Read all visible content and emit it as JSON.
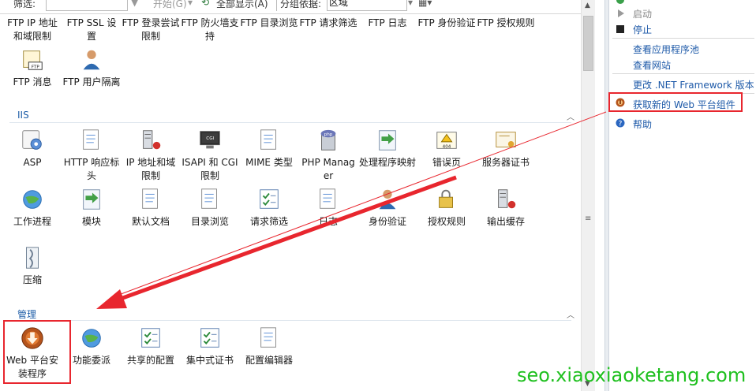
{
  "toolbar": {
    "filter_label": "筛选:",
    "start_label": "开始(G)",
    "show_all_label": "全部显示(A)",
    "group_by_label": "分组依据:",
    "group_by_value": "区域"
  },
  "ftp_row1": [
    {
      "label": "FTP IP 地址和域限制",
      "icon": "ftp-ip-restrictions-icon"
    },
    {
      "label": "FTP SSL 设置",
      "icon": "ftp-ssl-icon"
    },
    {
      "label": "FTP 登录尝试限制",
      "icon": "ftp-logon-attempt-icon"
    },
    {
      "label": "FTP 防火墙支持",
      "icon": "ftp-firewall-icon"
    },
    {
      "label": "FTP 目录浏览",
      "icon": "ftp-directory-browsing-icon"
    },
    {
      "label": "FTP 请求筛选",
      "icon": "ftp-request-filtering-icon"
    },
    {
      "label": "FTP 日志",
      "icon": "ftp-logging-icon"
    },
    {
      "label": "FTP 身份验证",
      "icon": "ftp-authentication-icon"
    },
    {
      "label": "FTP 授权规则",
      "icon": "ftp-authorization-icon"
    }
  ],
  "ftp_row2": [
    {
      "label": "FTP 消息",
      "icon": "ftp-messages-icon"
    },
    {
      "label": "FTP 用户隔离",
      "icon": "ftp-user-isolation-icon"
    }
  ],
  "iis": {
    "title": "IIS",
    "row1": [
      {
        "label": "ASP",
        "icon": "asp-icon"
      },
      {
        "label": "HTTP 响应标头",
        "icon": "http-response-headers-icon"
      },
      {
        "label": "IP 地址和域限制",
        "icon": "ip-restrictions-icon"
      },
      {
        "label": "ISAPI 和 CGI 限制",
        "icon": "isapi-cgi-icon"
      },
      {
        "label": "MIME 类型",
        "icon": "mime-types-icon"
      },
      {
        "label": "PHP Manager",
        "icon": "php-manager-icon"
      },
      {
        "label": "处理程序映射",
        "icon": "handler-mappings-icon"
      },
      {
        "label": "错误页",
        "icon": "error-pages-icon"
      },
      {
        "label": "服务器证书",
        "icon": "server-certificates-icon"
      }
    ],
    "row2": [
      {
        "label": "工作进程",
        "icon": "worker-processes-icon"
      },
      {
        "label": "模块",
        "icon": "modules-icon"
      },
      {
        "label": "默认文档",
        "icon": "default-document-icon"
      },
      {
        "label": "目录浏览",
        "icon": "directory-browsing-icon"
      },
      {
        "label": "请求筛选",
        "icon": "request-filtering-icon"
      },
      {
        "label": "日志",
        "icon": "logging-icon"
      },
      {
        "label": "身份验证",
        "icon": "authentication-icon"
      },
      {
        "label": "授权规则",
        "icon": "authorization-rules-icon"
      },
      {
        "label": "输出缓存",
        "icon": "output-caching-icon"
      }
    ],
    "row3": [
      {
        "label": "压缩",
        "icon": "compression-icon"
      }
    ]
  },
  "management": {
    "title": "管理",
    "items": [
      {
        "label": "Web 平台安装程序",
        "icon": "web-platform-installer-icon"
      },
      {
        "label": "功能委派",
        "icon": "feature-delegation-icon"
      },
      {
        "label": "共享的配置",
        "icon": "shared-configuration-icon"
      },
      {
        "label": "集中式证书",
        "icon": "centralized-certificates-icon"
      },
      {
        "label": "配置编辑器",
        "icon": "configuration-editor-icon"
      }
    ]
  },
  "actions": {
    "start": "启动",
    "stop": "停止",
    "view_app_pools": "查看应用程序池",
    "view_sites": "查看网站",
    "change_framework": "更改 .NET Framework 版本",
    "get_web_platform": "获取新的 Web 平台组件",
    "help": "帮助"
  },
  "colors": {
    "highlight": "#e8262e",
    "link": "#1d59a8",
    "watermark": "#1fc01f"
  },
  "watermark": "seo.xiaoxiaoketang.com"
}
